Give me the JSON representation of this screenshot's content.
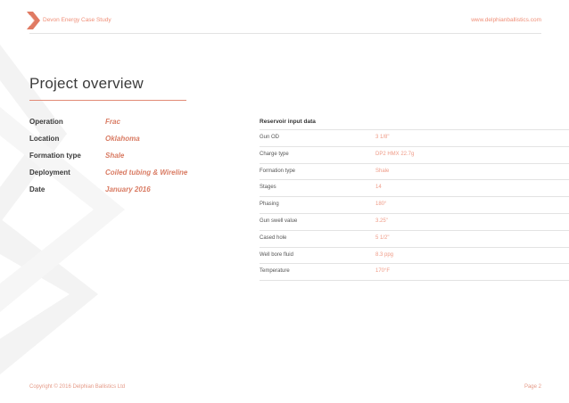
{
  "header": {
    "case_study": "Devon Energy Case Study",
    "website": "www.delphianballistics.com"
  },
  "main": {
    "title": "Project overview",
    "overview": [
      {
        "label": "Operation",
        "value": "Frac"
      },
      {
        "label": "Location",
        "value": "Oklahoma"
      },
      {
        "label": "Formation type",
        "value": "Shale"
      },
      {
        "label": "Deployment",
        "value": "Coiled tubing & Wireline"
      },
      {
        "label": "Date",
        "value": "January 2016"
      }
    ],
    "reservoir": {
      "heading": "Reservoir input data",
      "rows": [
        {
          "label": "Gun OD",
          "value": "3 1/8\""
        },
        {
          "label": "Charge type",
          "value": "DP2 HMX 22.7g"
        },
        {
          "label": "Formation type",
          "value": "Shale"
        },
        {
          "label": "Stages",
          "value": "14"
        },
        {
          "label": "Phasing",
          "value": "180°"
        },
        {
          "label": "Gun swell value",
          "value": "3.25\""
        },
        {
          "label": "Cased hole",
          "value": "5 1/2\""
        },
        {
          "label": "Well bore fluid",
          "value": "8.3 ppg"
        },
        {
          "label": "Temperature",
          "value": "170°F"
        }
      ]
    }
  },
  "footer": {
    "copyright": "Copyright © 2016 Delphian Ballistics Ltd",
    "page": "Page 2"
  },
  "colors": {
    "accent": "#d97b63",
    "accent_light": "#f08f78",
    "watermark": "#f3f3f3"
  },
  "icons": {
    "logo": "delphian-chevron-logo",
    "watermark": "chevron-watermark"
  }
}
